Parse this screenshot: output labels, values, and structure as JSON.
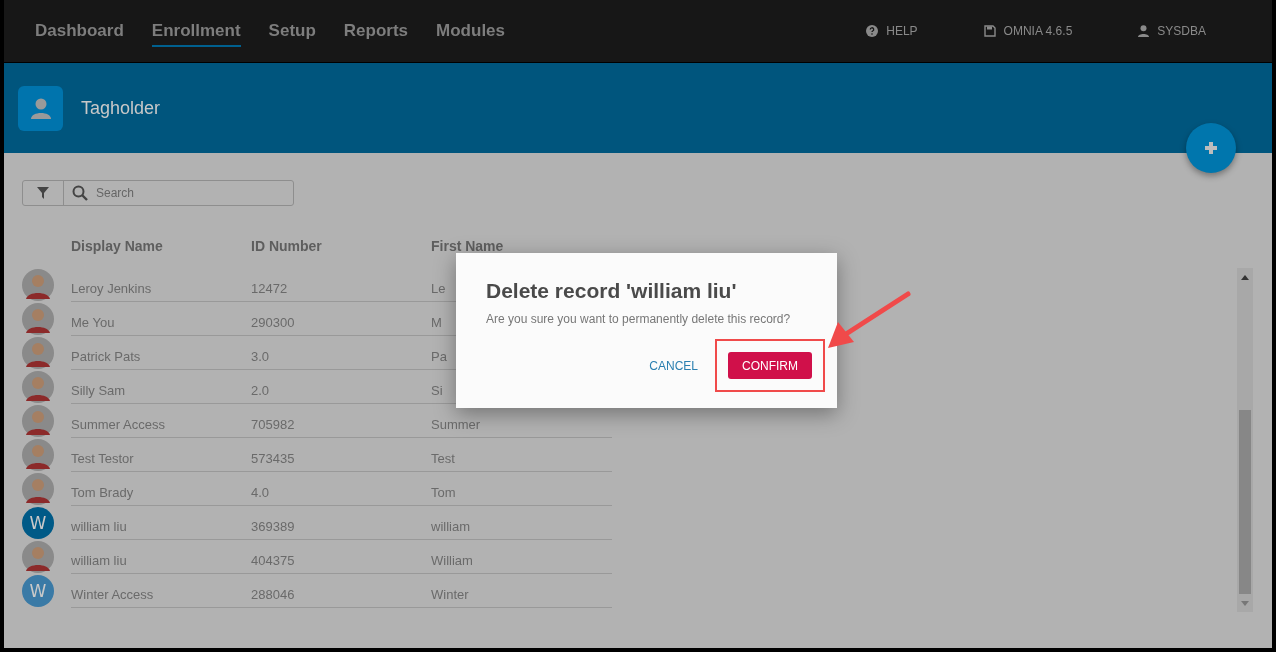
{
  "nav": {
    "items": [
      {
        "label": "Dashboard",
        "selected": false
      },
      {
        "label": "Enrollment",
        "selected": true
      },
      {
        "label": "Setup",
        "selected": false
      },
      {
        "label": "Reports",
        "selected": false
      },
      {
        "label": "Modules",
        "selected": false
      }
    ],
    "utilities": [
      {
        "kind": "help",
        "label": "HELP"
      },
      {
        "kind": "save",
        "label": "OMNIA 4.6.5"
      },
      {
        "kind": "user",
        "label": "SYSDBA"
      }
    ]
  },
  "header": {
    "title": "Tagholder"
  },
  "search": {
    "placeholder": "Search"
  },
  "table": {
    "columns": [
      "Display Name",
      "ID Number",
      "First Name"
    ],
    "rows": [
      {
        "cells": [
          "Leroy Jenkins",
          "12472",
          "Le"
        ]
      },
      {
        "cells": [
          "Me You",
          "290300",
          "M"
        ]
      },
      {
        "cells": [
          "Patrick Pats",
          "3.0",
          "Pa"
        ]
      },
      {
        "cells": [
          "Silly Sam",
          "2.0",
          "Si"
        ]
      },
      {
        "cells": [
          "Summer Access",
          "705982",
          "Summer"
        ]
      },
      {
        "cells": [
          "Test Testor",
          "573435",
          "Test"
        ]
      },
      {
        "cells": [
          "Tom Brady",
          "4.0",
          "Tom"
        ]
      },
      {
        "avatar": {
          "kind": "letter",
          "letter": "W",
          "color": "#005a87"
        },
        "cells": [
          "william liu",
          "369389",
          "william"
        ]
      },
      {
        "cells": [
          "william liu",
          "404375",
          "William"
        ]
      },
      {
        "avatar": {
          "kind": "letter",
          "letter": "W",
          "color": "#3a7aa6"
        },
        "cells": [
          "Winter Access",
          "288046",
          "Winter"
        ]
      }
    ]
  },
  "dialog": {
    "title": "Delete record 'william liu'",
    "message": "Are you sure you want to permanently delete this record?",
    "buttons": [
      {
        "kind": "text",
        "label": "CANCEL"
      },
      {
        "kind": "primary",
        "label": "CONFIRM",
        "highlighted": true
      }
    ]
  }
}
